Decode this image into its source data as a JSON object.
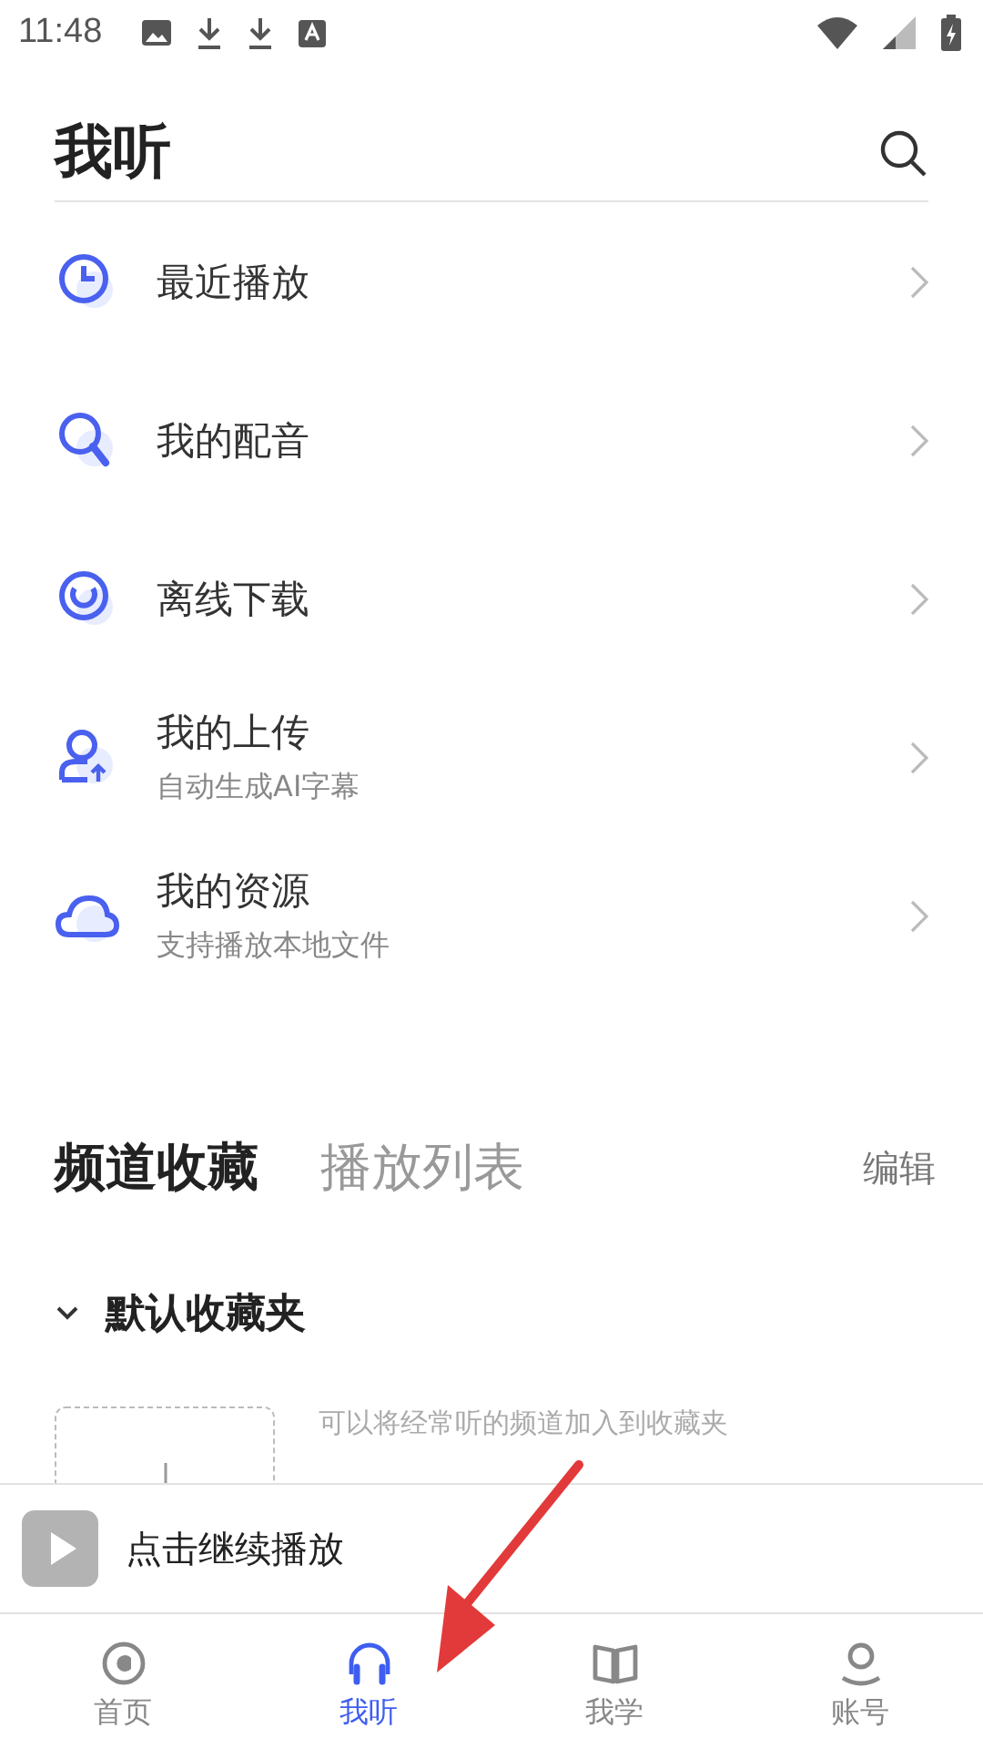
{
  "status_bar": {
    "time": "11:48"
  },
  "header": {
    "title": "我听"
  },
  "menu": [
    {
      "label": "最近播放"
    },
    {
      "label": "我的配音"
    },
    {
      "label": "离线下载"
    },
    {
      "label": "我的上传",
      "subtitle": "自动生成AI字幕"
    },
    {
      "label": "我的资源",
      "subtitle": "支持播放本地文件"
    }
  ],
  "tabs": [
    {
      "label": "频道收藏",
      "selected": true
    },
    {
      "label": "播放列表",
      "selected": false
    }
  ],
  "edit_label": "编辑",
  "folder": {
    "name": "默认收藏夹",
    "expanded": true,
    "hint": "可以将经常听的频道加入到收藏夹"
  },
  "mini_player": {
    "label": "点击继续播放"
  },
  "nav": [
    {
      "label": "首页",
      "selected": false
    },
    {
      "label": "我听",
      "selected": true
    },
    {
      "label": "我学",
      "selected": false
    },
    {
      "label": "账号",
      "selected": false
    }
  ]
}
